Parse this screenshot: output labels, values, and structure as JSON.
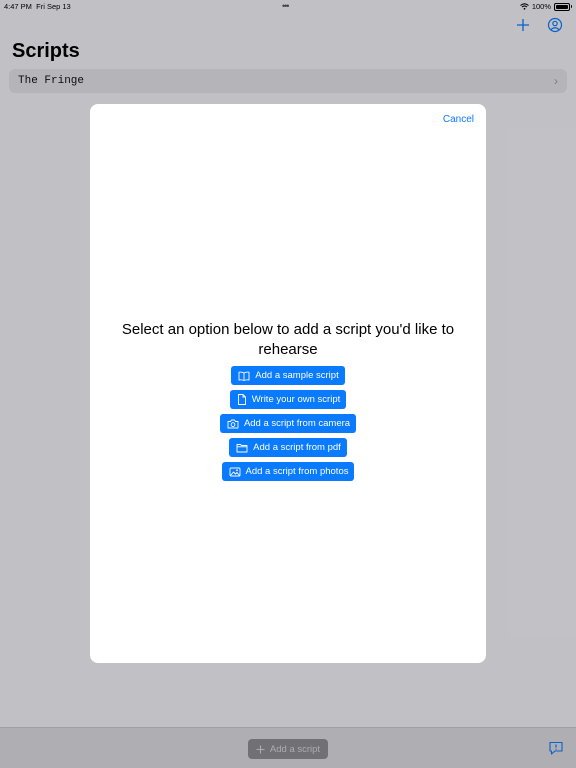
{
  "status": {
    "time": "4:47 PM",
    "date": "Fri Sep 13",
    "battery": "100%"
  },
  "page": {
    "title": "Scripts"
  },
  "scripts": [
    {
      "title": "The Fringe"
    }
  ],
  "bottom_bar": {
    "add_script_label": "Add a script"
  },
  "modal": {
    "cancel_label": "Cancel",
    "prompt": "Select an option below to add a script you'd like to rehearse",
    "options": [
      {
        "label": "Add a sample script",
        "icon": "book-icon"
      },
      {
        "label": "Write your own script",
        "icon": "document-icon"
      },
      {
        "label": "Add a script from camera",
        "icon": "camera-icon"
      },
      {
        "label": "Add a script from pdf",
        "icon": "folder-icon"
      },
      {
        "label": "Add a script from photos",
        "icon": "photo-icon"
      }
    ]
  },
  "colors": {
    "accent": "#0a7aff",
    "background": "#f2f2f7"
  }
}
